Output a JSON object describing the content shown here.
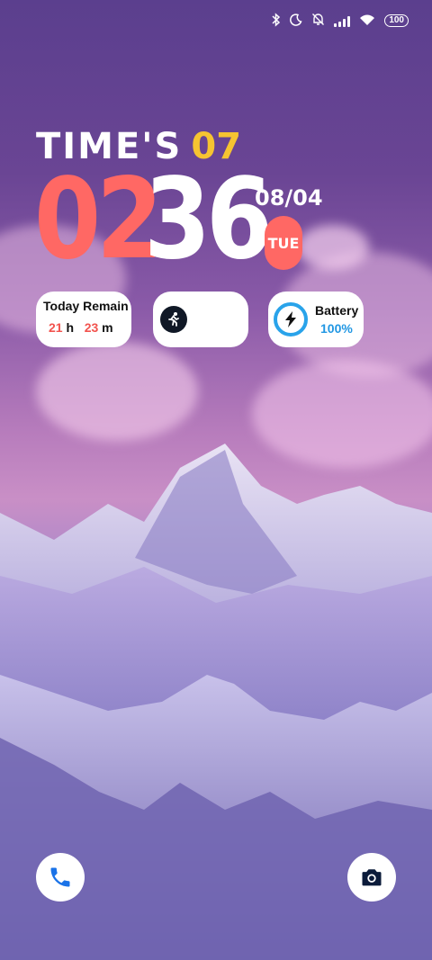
{
  "status_bar": {
    "icons": [
      "bluetooth-icon",
      "do-not-disturb-moon-icon",
      "silent-bell-icon",
      "signal-icon",
      "wifi-icon",
      "battery-icon"
    ],
    "battery_level": "100"
  },
  "clock_widget": {
    "title": "TIME'S",
    "title_number": "07",
    "hours": "02",
    "minutes": "36",
    "date": "08/04",
    "weekday": "TUE",
    "colors": {
      "accent_red": "#ff6864",
      "accent_yellow": "#f6c431",
      "battery_blue": "#29a3ea"
    }
  },
  "widgets": {
    "today_remain": {
      "label": "Today Remain",
      "hours": "21",
      "hours_unit": "h",
      "minutes": "23",
      "minutes_unit": "m"
    },
    "activity": {
      "icon": "running-person-icon"
    },
    "battery": {
      "label": "Battery",
      "value": "100%",
      "icon": "lightning-bolt-icon"
    }
  },
  "shortcuts": {
    "left": {
      "icon": "phone-icon",
      "color": "#1a73e8"
    },
    "right": {
      "icon": "camera-icon",
      "color": "#0b1b3a"
    }
  }
}
